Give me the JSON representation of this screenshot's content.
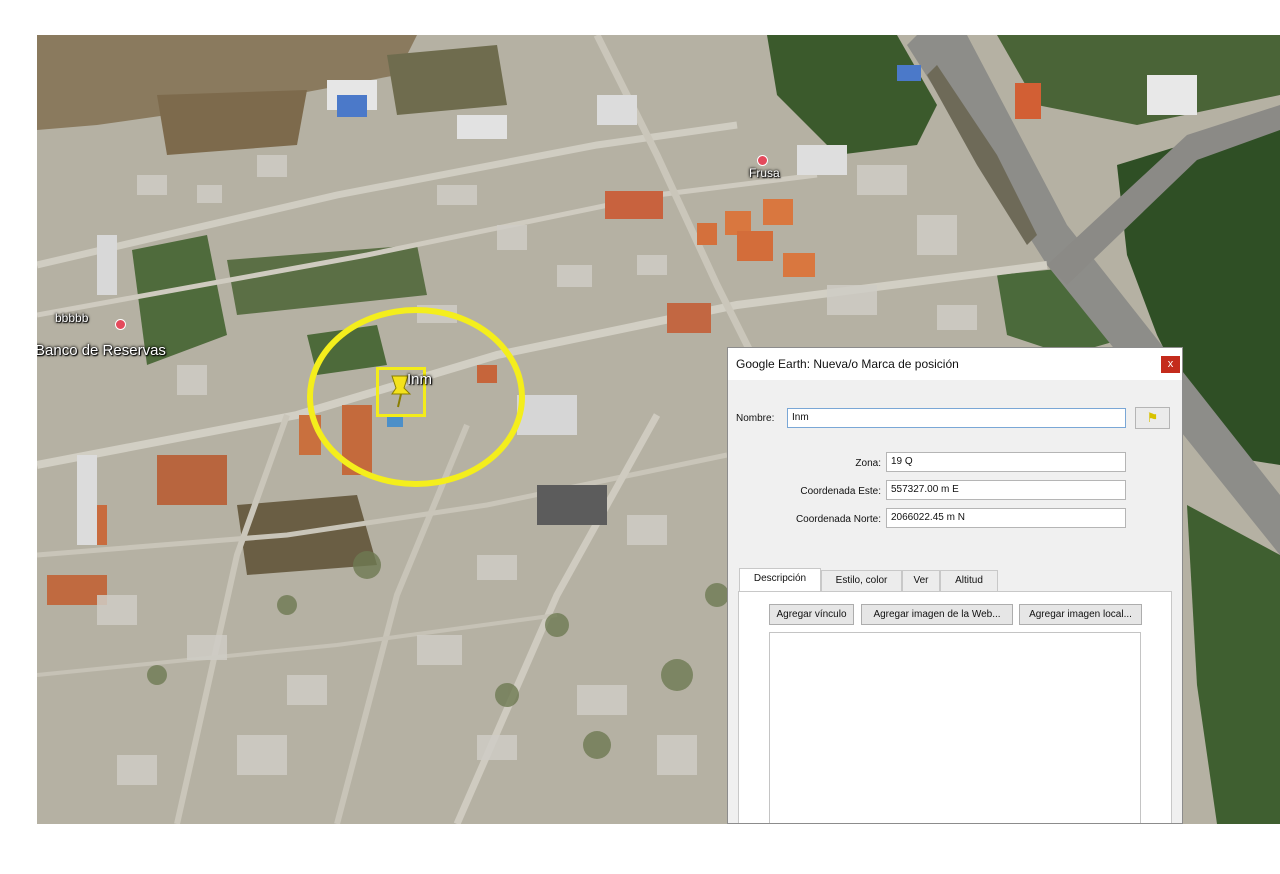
{
  "map": {
    "labels": {
      "bbbbb": "bbbbb",
      "banco": "Banco de Reservas",
      "frusa": "Frusa",
      "pin": "Inm"
    },
    "icons": [
      "placemark-pin-icon",
      "poi-icon"
    ],
    "highlight_color": "#f4ee1c"
  },
  "dialog": {
    "title": "Google Earth: Nueva/o Marca de posición",
    "close_label": "x",
    "nombre_label": "Nombre:",
    "nombre_value": "Inm",
    "pin_button_icon": "pushpin-icon",
    "zona_label": "Zona:",
    "zona_value": "19 Q",
    "este_label": "Coordenada Este:",
    "este_value": "557327.00 m E",
    "norte_label": "Coordenada Norte:",
    "norte_value": "2066022.45 m N",
    "tabs": [
      {
        "label": "Descripción"
      },
      {
        "label": "Estilo, color"
      },
      {
        "label": "Ver"
      },
      {
        "label": "Altitud"
      }
    ],
    "buttons": {
      "link": "Agregar vínculo",
      "web_image": "Agregar imagen de la Web...",
      "local_image": "Agregar imagen local..."
    }
  }
}
